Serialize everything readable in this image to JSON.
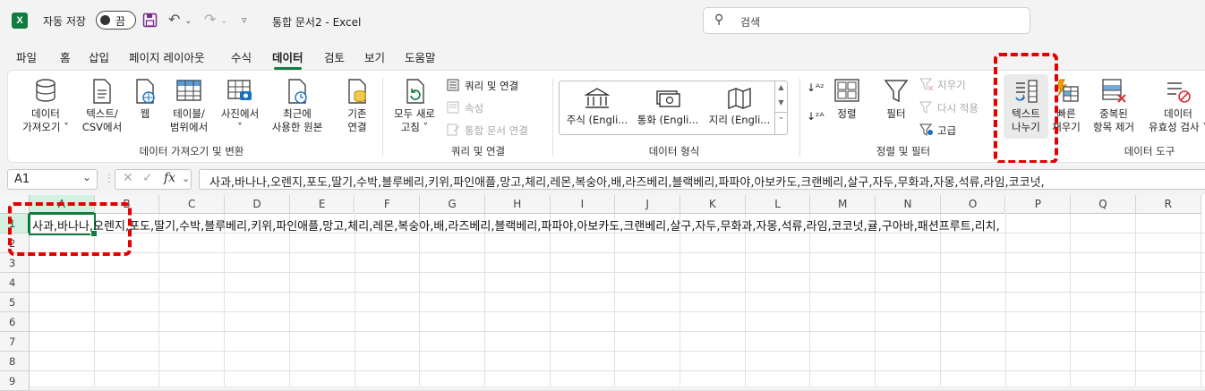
{
  "titlebar": {
    "autosave_label": "자동 저장",
    "autosave_state": "끔",
    "document_title": "통합 문서2  -  Excel",
    "search_placeholder": "검색"
  },
  "menu": [
    "파일",
    "홈",
    "삽입",
    "페이지 레이아웃",
    "수식",
    "데이터",
    "검토",
    "보기",
    "도움말"
  ],
  "active_menu": "데이터",
  "ribbon": {
    "get_data": {
      "buttons": [
        "데이터\n가져오기 ˅",
        "텍스트/\nCSV에서",
        "웹",
        "테이블/\n범위에서",
        "사진에서\n˅",
        "최근에\n사용한 원본",
        "기존\n연결"
      ],
      "label": "데이터 가져오기 및 변환"
    },
    "queries": {
      "refresh_all": "모두 새로\n고침 ˅",
      "queries_connections": "쿼리 및 연결",
      "properties": "속성",
      "edit_links": "통합 문서 연결",
      "label": "쿼리 및 연결"
    },
    "data_types": {
      "items": [
        "주식 (Engli...",
        "통화 (Engli...",
        "지리 (Engli..."
      ],
      "label": "데이터 형식"
    },
    "sort_filter": {
      "sort": "정렬",
      "filter": "필터",
      "clear": "지우기",
      "reapply": "다시 적용",
      "advanced": "고급",
      "label": "정렬 및 필터"
    },
    "data_tools": {
      "text_to_columns": "텍스트\n나누기",
      "flash_fill": "빠른\n채우기",
      "remove_duplicates": "중복된\n항목 제거",
      "data_validation": "데이터\n유효성 검사 ˅",
      "label": "데이터 도구"
    }
  },
  "formula_bar": {
    "name_box": "A1",
    "fx": "fx",
    "formula": "사과,바나나,오렌지,포도,딸기,수박,블루베리,키위,파인애플,망고,체리,레몬,복숭아,배,라즈베리,블랙베리,파파야,아보카도,크랜베리,살구,자두,무화과,자몽,석류,라임,코코넛,"
  },
  "sheet": {
    "columns": [
      "A",
      "B",
      "C",
      "D",
      "E",
      "F",
      "G",
      "H",
      "I",
      "J",
      "K",
      "L",
      "M",
      "N",
      "O",
      "P",
      "Q",
      "R"
    ],
    "rows": [
      "1",
      "2",
      "3",
      "4",
      "5",
      "6",
      "7",
      "8",
      "9"
    ],
    "a1_value": "사과,바나나,오렌지,포도,딸기,수박,블루베리,키위,파인애플,망고,체리,레몬,복숭아,배,라즈베리,블랙베리,파파야,아보카도,크랜베리,살구,자두,무화과,자몽,석류,라임,코코넛,귤,구아바,패션프루트,리치,",
    "selected_cell": "A1"
  },
  "colors": {
    "accent": "#107c41",
    "annotation": "#e30000"
  }
}
